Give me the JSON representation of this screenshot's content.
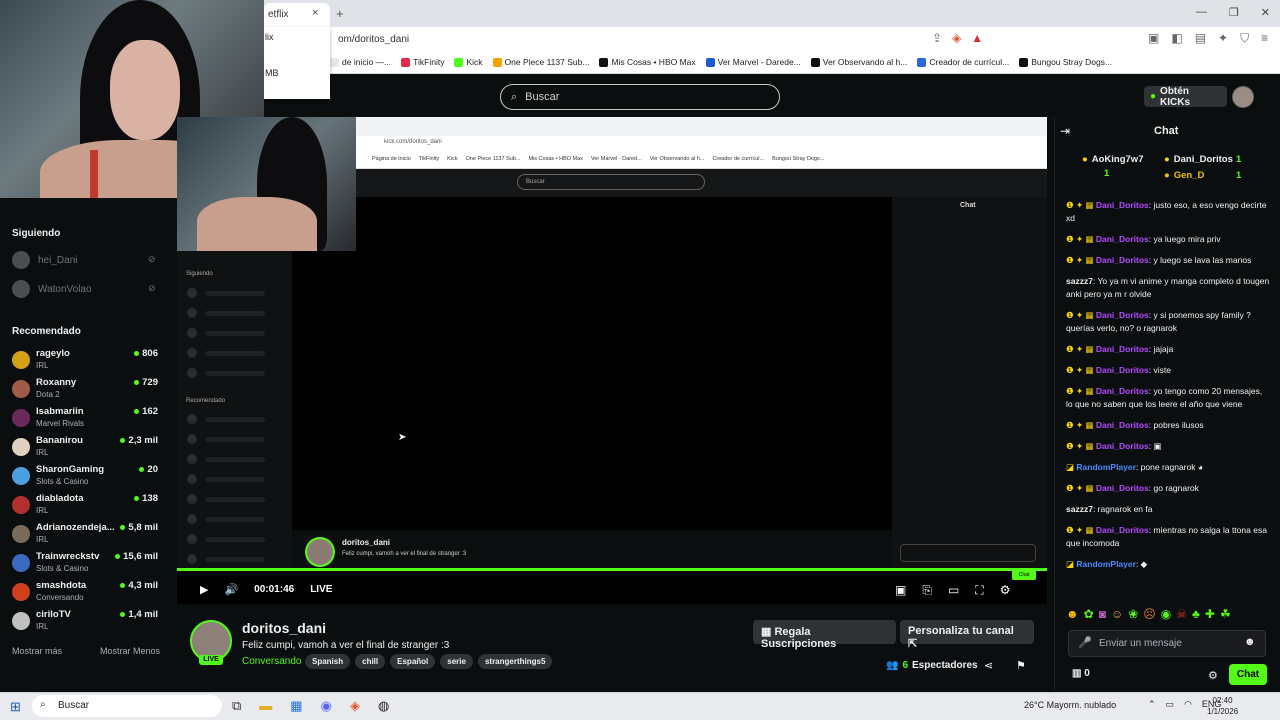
{
  "browser": {
    "tab_label": "etflix",
    "tab_close": "×",
    "new_tab": "+",
    "window_controls": [
      "—",
      "❐",
      "✕"
    ],
    "url": "om/doritos_dani",
    "dropdown": [
      "lix",
      "MB"
    ],
    "bookmarks": [
      {
        "label": "de inicio —...",
        "color": "#e8e8e8"
      },
      {
        "label": "TikFinity",
        "color": "#e02b4a"
      },
      {
        "label": "Kick",
        "color": "#53fc18"
      },
      {
        "label": "One Piece 1137 Sub...",
        "color": "#f2a400"
      },
      {
        "label": "Mis Cosas • HBO Max",
        "color": "#111111"
      },
      {
        "label": "Ver Marvel - Daredе...",
        "color": "#1d5bd6"
      },
      {
        "label": "Ver Observando al h...",
        "color": "#111111"
      },
      {
        "label": "Creador de currícul...",
        "color": "#2b67d9"
      },
      {
        "label": "Bungou Stray Dogs...",
        "color": "#111111"
      }
    ]
  },
  "kick": {
    "search_placeholder": "Buscar",
    "kicks_button": "Obtén KICKs"
  },
  "sidebar": {
    "following_title": "Siguiendo",
    "following": [
      {
        "name": "hei_Dani"
      },
      {
        "name": "WatonVolao"
      }
    ],
    "recommended_title": "Recomendado",
    "recommended": [
      {
        "name": "rageylo",
        "category": "IRL",
        "viewers": "806",
        "color": "#d4a017"
      },
      {
        "name": "Roxanny",
        "category": "Dota 2",
        "viewers": "729",
        "color": "#a05a4a"
      },
      {
        "name": "Isabmariin",
        "category": "Marvel Rivals",
        "viewers": "162",
        "color": "#6b2a5a"
      },
      {
        "name": "Bananirou",
        "category": "IRL",
        "viewers": "2,3 mil",
        "color": "#e0d0c0"
      },
      {
        "name": "SharonGaming",
        "category": "Slots & Casino",
        "viewers": "20",
        "color": "#4aa0e0"
      },
      {
        "name": "diabladota",
        "category": "IRL",
        "viewers": "138",
        "color": "#b03030"
      },
      {
        "name": "Adrianozendeja...",
        "category": "IRL",
        "viewers": "5,8 mil",
        "color": "#7a6a5a"
      },
      {
        "name": "Trainwreckstv",
        "category": "Slots & Casino",
        "viewers": "15,6 mil",
        "color": "#3a6ac0"
      },
      {
        "name": "smashdota",
        "category": "Conversando",
        "viewers": "4,3 mil",
        "color": "#d04020"
      },
      {
        "name": "ciriloTV",
        "category": "IRL",
        "viewers": "1,4 mil",
        "color": "#c0c0c0"
      }
    ],
    "show_more": "Mostrar más",
    "show_less": "Mostrar Menos"
  },
  "nested": {
    "url": "kick.com/doritos_dani",
    "search": "Buscar",
    "following": "Siguiendo",
    "recommended": "Recomendado",
    "chat": "Chat",
    "streamer": "doritos_dani",
    "title": "Feliz cumpi, vamoh a ver el final de stranger :3",
    "chat_btn": "Chat",
    "bookmarks": [
      "Página de inicio",
      "TikFinity",
      "Kick",
      "One Piece 1137 Sub...",
      "Mis Cosas • HBO Max",
      "Ver Marvel - Dared...",
      "Ver Observando al h...",
      "Creador de currícul...",
      "Bungou Stray Dogs..."
    ]
  },
  "player": {
    "time": "00:01:46",
    "live": "LIVE"
  },
  "stream": {
    "streamer": "doritos_dani",
    "live_badge": "LIVE",
    "title": "Feliz cumpi, vamoh a ver el final de stranger :3",
    "category": "Conversando",
    "tags": [
      "Spanish",
      "chill",
      "Español",
      "serie",
      "strangerthings5"
    ],
    "gift_button": "Regala Suscripciones",
    "customize_button": "Personaliza tu canal",
    "viewers_count": "6",
    "viewers_label": "Espectadores"
  },
  "chat": {
    "title": "Chat",
    "leaders": [
      {
        "name": "AoKing7w7",
        "count": "1"
      },
      {
        "name": "Dani_Doritos",
        "count": "1"
      },
      {
        "name": "Gen_D",
        "count": "1"
      }
    ],
    "messages": [
      {
        "user": "Dani_Doritos",
        "color": "#b44bff",
        "badges": "❶ ✦ ▦",
        "text": "justo eso, a eso vengo decirte xd"
      },
      {
        "user": "Dani_Doritos",
        "color": "#b44bff",
        "badges": "❶ ✦ ▦",
        "text": "ya luego mira priv"
      },
      {
        "user": "Dani_Doritos",
        "color": "#b44bff",
        "badges": "❶ ✦ ▦",
        "text": "y luego se lava las manos"
      },
      {
        "user": "sazzz7",
        "color": "#efeff1",
        "badges": "",
        "text": "Yo ya m vi anime y manga completo d tougen anki pero ya m r olvide"
      },
      {
        "user": "Dani_Doritos",
        "color": "#b44bff",
        "badges": "❶ ✦ ▦",
        "text": "y si ponemos spy family ? querías verlo, no? o ragnarok"
      },
      {
        "user": "Dani_Doritos",
        "color": "#b44bff",
        "badges": "❶ ✦ ▦",
        "text": "jajaja"
      },
      {
        "user": "Dani_Doritos",
        "color": "#b44bff",
        "badges": "❶ ✦ ▦",
        "text": "viste"
      },
      {
        "user": "Dani_Doritos",
        "color": "#b44bff",
        "badges": "❶ ✦ ▦",
        "text": "yo tengo como 20 mensajes, lo que no saben que los leere el año que viene"
      },
      {
        "user": "Dani_Doritos",
        "color": "#b44bff",
        "badges": "❶ ✦ ▦",
        "text": "pobres ilusos"
      },
      {
        "user": "Dani_Doritos",
        "color": "#b44bff",
        "badges": "❶ ✦ ▦",
        "text": "▣"
      },
      {
        "user": "RandomPlayer",
        "color": "#4b8bff",
        "badges": "◪",
        "text": "pone ragnarok ◕"
      },
      {
        "user": "Dani_Doritos",
        "color": "#b44bff",
        "badges": "❶ ✦ ▦",
        "text": "go ragnarok"
      },
      {
        "user": "sazzz7",
        "color": "#efeff1",
        "badges": "",
        "text": "ragnarok en fa"
      },
      {
        "user": "Dani_Doritos",
        "color": "#b44bff",
        "badges": "❶ ✦ ▦",
        "text": "mientras no salga la ttona esa que incomoda"
      },
      {
        "user": "RandomPlayer",
        "color": "#4b8bff",
        "badges": "◪",
        "text": "◆"
      }
    ],
    "emotes": [
      "☻",
      "✿",
      "◙",
      "☺",
      "❀",
      "☹",
      "◉",
      "☠",
      "♣",
      "✚",
      "☘"
    ],
    "input_placeholder": "Enviar un mensaje",
    "points": "0",
    "chat_button": "Chat"
  },
  "taskbar": {
    "search": "Buscar",
    "weather": "26°C  Mayorm. nublado",
    "lang": "ENG",
    "time": "02:40",
    "date": "1/1/2026"
  }
}
